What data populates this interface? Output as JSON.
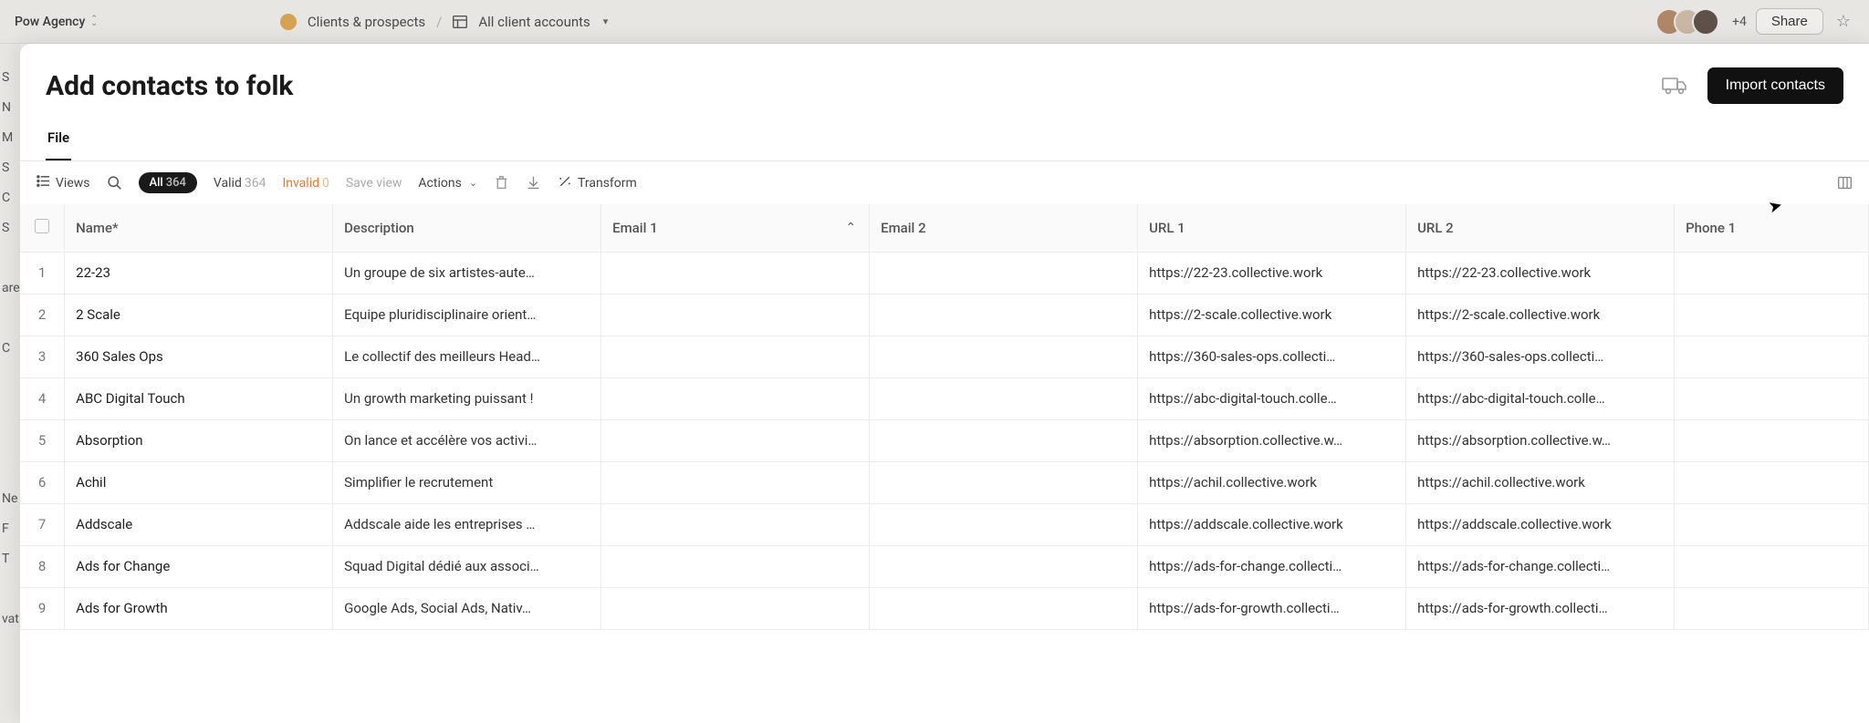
{
  "header": {
    "workspace": "Pow Agency",
    "breadcrumb_group": "Clients & prospects",
    "breadcrumb_view": "All client accounts",
    "plus_count": "+4",
    "share_label": "Share"
  },
  "panel": {
    "title": "Add contacts to folk",
    "import_label": "Import contacts",
    "tab_file": "File"
  },
  "toolbar": {
    "views_label": "Views",
    "pill_all_label": "All",
    "pill_all_count": "364",
    "valid_label": "Valid",
    "valid_count": "364",
    "invalid_label": "Invalid",
    "invalid_count": "0",
    "save_view_label": "Save view",
    "actions_label": "Actions",
    "transform_label": "Transform"
  },
  "columns": {
    "name": "Name*",
    "description": "Description",
    "email1": "Email 1",
    "email2": "Email 2",
    "url1": "URL 1",
    "url2": "URL 2",
    "phone1": "Phone 1"
  },
  "rows": [
    {
      "idx": "1",
      "name": "22-23",
      "desc": "Un groupe de six artistes-aute…",
      "url1": "https://22-23.collective.work",
      "url2": "https://22-23.collective.work"
    },
    {
      "idx": "2",
      "name": "2 Scale",
      "desc": "Equipe pluridisciplinaire orient…",
      "url1": "https://2-scale.collective.work",
      "url2": "https://2-scale.collective.work"
    },
    {
      "idx": "3",
      "name": "360 Sales Ops",
      "desc": "Le collectif des meilleurs Head…",
      "url1": "https://360-sales-ops.collecti…",
      "url2": "https://360-sales-ops.collecti…"
    },
    {
      "idx": "4",
      "name": "ABC Digital Touch",
      "desc": "Un growth marketing puissant !",
      "url1": "https://abc-digital-touch.colle…",
      "url2": "https://abc-digital-touch.colle…"
    },
    {
      "idx": "5",
      "name": "Absorption",
      "desc": "On lance et accélère vos activi…",
      "url1": "https://absorption.collective.w…",
      "url2": "https://absorption.collective.w…"
    },
    {
      "idx": "6",
      "name": "Achil",
      "desc": "Simplifier le recrutement",
      "url1": "https://achil.collective.work",
      "url2": "https://achil.collective.work"
    },
    {
      "idx": "7",
      "name": "Addscale",
      "desc": "Addscale aide les entreprises …",
      "url1": "https://addscale.collective.work",
      "url2": "https://addscale.collective.work"
    },
    {
      "idx": "8",
      "name": "Ads for Change",
      "desc": "Squad Digital dédié aux associ…",
      "url1": "https://ads-for-change.collecti…",
      "url2": "https://ads-for-change.collecti…"
    },
    {
      "idx": "9",
      "name": "Ads for Growth",
      "desc": "Google Ads, Social Ads, Nativ…",
      "url1": "https://ads-for-growth.collecti…",
      "url2": "https://ads-for-growth.collecti…"
    }
  ],
  "bg_items": [
    "S",
    "N",
    "M",
    "S",
    "C",
    "S",
    "",
    "are",
    "",
    "C",
    "",
    "",
    "",
    "",
    "Ne",
    "F",
    "T",
    "",
    "vat"
  ]
}
